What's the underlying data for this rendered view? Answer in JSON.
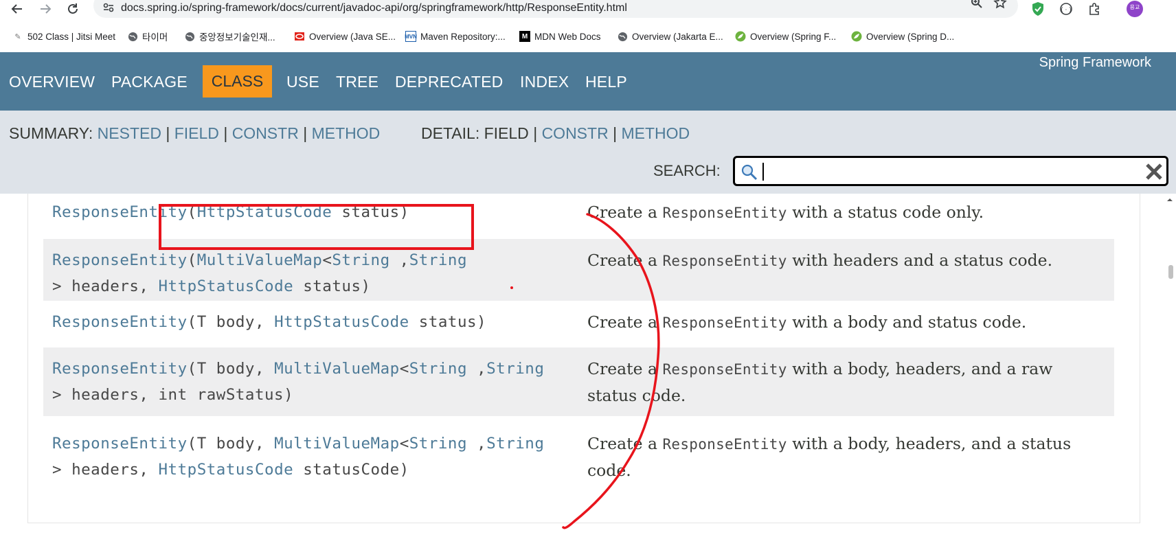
{
  "browser": {
    "url": "docs.spring.io/spring-framework/docs/current/javadoc-api/org/springframework/http/ResponseEntity.html",
    "profile_initials": "용교",
    "bookmarks": [
      {
        "label": "502 Class | Jitsi Meet",
        "icon": "jitsi-icon"
      },
      {
        "label": "타이머",
        "icon": "globe-icon"
      },
      {
        "label": "중앙정보기술인재...",
        "icon": "globe-icon"
      },
      {
        "label": "Overview (Java SE...",
        "icon": "oracle-icon"
      },
      {
        "label": "Maven Repository:...",
        "icon": "maven-icon"
      },
      {
        "label": "MDN Web Docs",
        "icon": "mdn-icon"
      },
      {
        "label": "Overview (Jakarta E...",
        "icon": "globe-icon"
      },
      {
        "label": "Overview (Spring F...",
        "icon": "spring-icon"
      },
      {
        "label": "Overview (Spring D...",
        "icon": "spring-icon"
      }
    ]
  },
  "javadoc": {
    "about": "Spring Framework",
    "nav": {
      "overview": "OVERVIEW",
      "package": "PACKAGE",
      "class": "CLASS",
      "use": "USE",
      "tree": "TREE",
      "deprecated": "DEPRECATED",
      "index": "INDEX",
      "help": "HELP"
    },
    "summary": {
      "label": "SUMMARY:",
      "nested": "NESTED",
      "field": "FIELD",
      "constr": "CONSTR",
      "method": "METHOD",
      "sep": "|"
    },
    "detail": {
      "label": "DETAIL:",
      "field": "FIELD",
      "constr": "CONSTR",
      "method": "METHOD"
    },
    "search": {
      "label": "SEARCH:",
      "value": ""
    }
  },
  "constructors": [
    {
      "sig_line1": [
        {
          "t": "ResponseEntity",
          "link": true
        },
        {
          "t": "(",
          "link": false
        },
        {
          "t": "HttpStatusCode",
          "link": true
        },
        {
          "t": " status)",
          "link": false
        }
      ],
      "sig_line2": [],
      "desc_pre": "Create a ",
      "desc_code": "ResponseEntity",
      "desc_post": " with a status code only.",
      "desc_line2": ""
    },
    {
      "sig_line1": [
        {
          "t": "ResponseEntity",
          "link": true
        },
        {
          "t": "(",
          "link": false
        },
        {
          "t": "MultiValueMap",
          "link": true
        },
        {
          "t": "<",
          "link": false
        },
        {
          "t": "String",
          "link": true
        },
        {
          "t": " ,",
          "link": false
        },
        {
          "t": "String",
          "link": true
        }
      ],
      "sig_line2": [
        {
          "t": "> headers, ",
          "link": false
        },
        {
          "t": "HttpStatusCode",
          "link": true
        },
        {
          "t": " status)",
          "link": false
        }
      ],
      "desc_pre": "Create a ",
      "desc_code": "ResponseEntity",
      "desc_post": " with headers and a status code.",
      "desc_line2": ""
    },
    {
      "sig_line1": [
        {
          "t": "ResponseEntity",
          "link": true
        },
        {
          "t": "(T body, ",
          "link": false
        },
        {
          "t": "HttpStatusCode",
          "link": true
        },
        {
          "t": " status)",
          "link": false
        }
      ],
      "sig_line2": [],
      "desc_pre": "Create a ",
      "desc_code": "ResponseEntity",
      "desc_post": " with a body and status code.",
      "desc_line2": ""
    },
    {
      "sig_line1": [
        {
          "t": "ResponseEntity",
          "link": true
        },
        {
          "t": "(T body, ",
          "link": false
        },
        {
          "t": "MultiValueMap",
          "link": true
        },
        {
          "t": "<",
          "link": false
        },
        {
          "t": "String",
          "link": true
        },
        {
          "t": " ,",
          "link": false
        },
        {
          "t": "String",
          "link": true
        }
      ],
      "sig_line2": [
        {
          "t": "> headers, int rawStatus)",
          "link": false
        }
      ],
      "desc_pre": "Create a ",
      "desc_code": "ResponseEntity",
      "desc_post": " with a body, headers, and a raw",
      "desc_line2": "status code."
    },
    {
      "sig_line1": [
        {
          "t": "ResponseEntity",
          "link": true
        },
        {
          "t": "(T body, ",
          "link": false
        },
        {
          "t": "MultiValueMap",
          "link": true
        },
        {
          "t": "<",
          "link": false
        },
        {
          "t": "String",
          "link": true
        },
        {
          "t": " ,",
          "link": false
        },
        {
          "t": "String",
          "link": true
        }
      ],
      "sig_line2": [
        {
          "t": "> headers, ",
          "link": false
        },
        {
          "t": "HttpStatusCode",
          "link": true
        },
        {
          "t": " statusCode)",
          "link": false
        }
      ],
      "desc_pre": "Create a ",
      "desc_code": "ResponseEntity",
      "desc_post": " with a body, headers, and a status",
      "desc_line2": "code."
    }
  ],
  "colors": {
    "header_bg": "#4d7a97",
    "active_tab": "#f8981d",
    "subnav_bg": "#dee3e9",
    "link": "#4d7a97",
    "annotation": "#e8141c"
  }
}
